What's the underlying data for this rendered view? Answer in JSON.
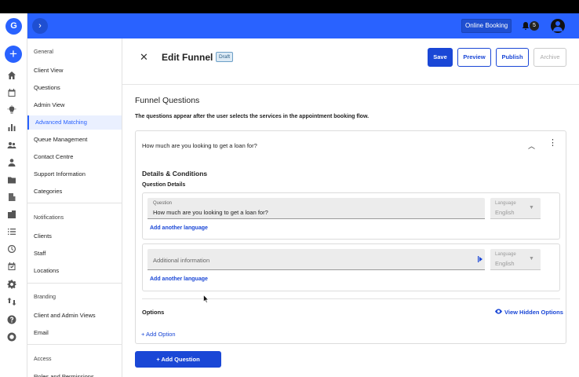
{
  "rail": {
    "avatar_letter": "G",
    "add_symbol": "+",
    "icons": [
      "home-icon",
      "calendar-icon",
      "lightbulb-icon",
      "bar-chart-icon",
      "users-icon",
      "person-icon",
      "folder-icon",
      "building-icon",
      "apartment-icon",
      "list-icon",
      "clock-icon",
      "calendar-check-icon",
      "settings-icon",
      "swap-icon",
      "help-icon",
      "lifebuoy-icon"
    ]
  },
  "topbar": {
    "expand_symbol": "›",
    "online_booking": "Online Booking",
    "notification_count": "5",
    "color": "#2962ff"
  },
  "sidenav": {
    "general_heading": "General",
    "general": [
      "Client View",
      "Questions",
      "Admin View",
      "Advanced Matching",
      "Queue Management",
      "Contact Centre",
      "Support Information",
      "Categories"
    ],
    "active_item": "Advanced Matching",
    "notifications_heading": "Notifications",
    "notifications": [
      "Clients",
      "Staff",
      "Locations"
    ],
    "branding_heading": "Branding",
    "branding": [
      "Client and Admin Views",
      "Email"
    ],
    "access_heading": "Access",
    "access": [
      "Roles and Permissions"
    ]
  },
  "header": {
    "close_symbol": "✕",
    "title": "Edit Funnel",
    "status_badge": "Draft",
    "save": "Save",
    "preview": "Preview",
    "publish": "Publish",
    "archive": "Archive"
  },
  "funnel": {
    "title": "Funnel Questions",
    "description": "The questions appear after the user selects the services in the appointment booking flow."
  },
  "question_card": {
    "question_title": "How much are you looking to get a loan for?",
    "collapse_symbol": "︿",
    "menu_symbol": "⋮",
    "details_heading": "Details & Conditions",
    "question_details_heading": "Question Details",
    "question_field": {
      "label": "Question",
      "value": "How much are you looking to get a loan for?"
    },
    "question_language": {
      "label": "Language",
      "value": "English"
    },
    "add_language_1": "Add another language",
    "additional_info_field": {
      "placeholder": "Additional information"
    },
    "additional_language": {
      "label": "Language",
      "value": "English"
    },
    "add_language_2": "Add another language",
    "options_heading": "Options",
    "view_hidden_options": "View Hidden Options",
    "add_option": "+ Add Option"
  },
  "add_question": "+   Add Question",
  "colors": {
    "primary": "#1a47d6",
    "brand": "#2962ff",
    "draft_bg": "#dceaf5"
  }
}
